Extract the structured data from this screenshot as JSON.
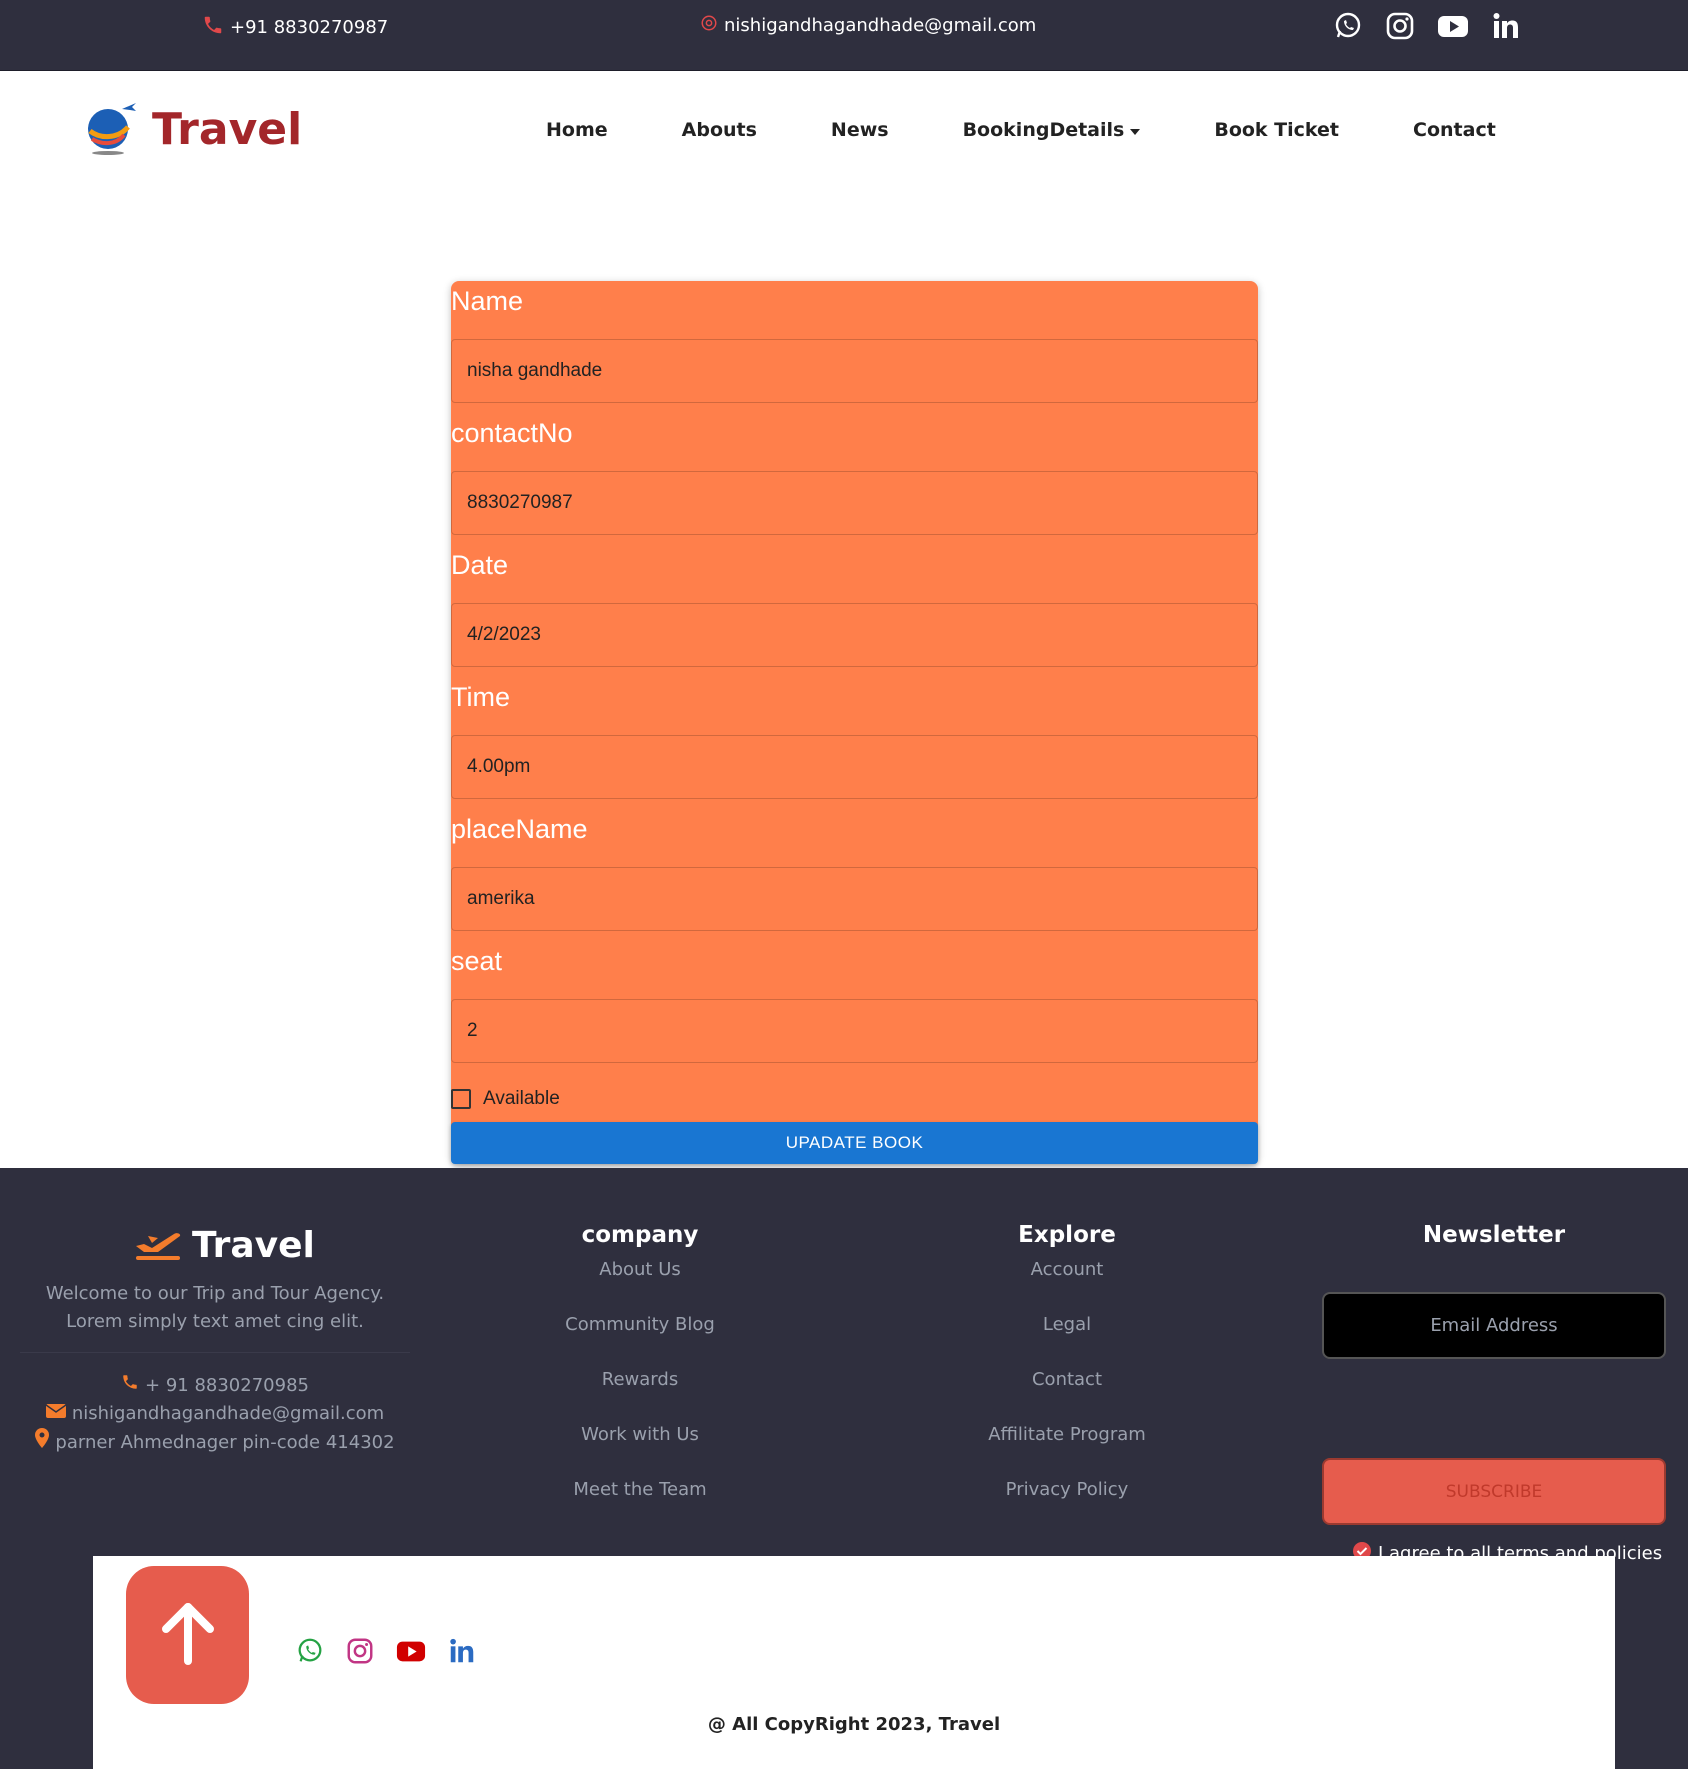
{
  "topbar": {
    "phone": "+91 8830270987",
    "email": "nishigandhagandhade@gmail.com",
    "social_icons": [
      "whatsapp-icon",
      "instagram-icon",
      "youtube-icon",
      "linkedin-icon"
    ]
  },
  "navbar": {
    "brand": "Travel",
    "items": [
      {
        "label": "Home"
      },
      {
        "label": "Abouts"
      },
      {
        "label": "News"
      },
      {
        "label": "BookingDetails"
      },
      {
        "label": "Book Ticket"
      },
      {
        "label": "Contact"
      }
    ]
  },
  "form": {
    "name_label": "Name",
    "name_value": "nisha gandhade",
    "contact_label": "contactNo",
    "contact_value": "8830270987",
    "date_label": "Date",
    "date_value": "4/2/2023",
    "time_label": "Time",
    "time_value": "4.00pm",
    "place_label": "placeName",
    "place_value": "amerika",
    "seat_label": "seat",
    "seat_value": "2",
    "available_label": "Available",
    "available_checked": false,
    "submit_label": "UPADATE BOOK"
  },
  "footer": {
    "brand": "Travel",
    "description_line1": "Welcome to our Trip and Tour Agency.",
    "description_line2": "Lorem simply text amet cing elit.",
    "phone": "+ 91 8830270985",
    "email": "nishigandhagandhade@gmail.com",
    "address": "parner Ahmednager pin-code 414302",
    "company": {
      "title": "company",
      "links": [
        "About Us",
        "Community Blog",
        "Rewards",
        "Work with Us",
        "Meet the Team"
      ]
    },
    "explore": {
      "title": "Explore",
      "links": [
        "Account",
        "Legal",
        "Contact",
        "Affilitate Program",
        "Privacy Policy"
      ]
    },
    "newsletter": {
      "title": "Newsletter",
      "email_placeholder": "Email Address",
      "subscribe_label": "SUBSCRIBE",
      "agree_text": "I agree to all terms and policies"
    },
    "copyright": "@ All CopyRight 2023, Travel"
  },
  "colors": {
    "topbar_bg": "#2f2f3e",
    "brand_red": "#a3262a",
    "form_bg": "#ff7f4b",
    "button_blue": "#1976d2",
    "accent_red": "#e65c4d"
  }
}
